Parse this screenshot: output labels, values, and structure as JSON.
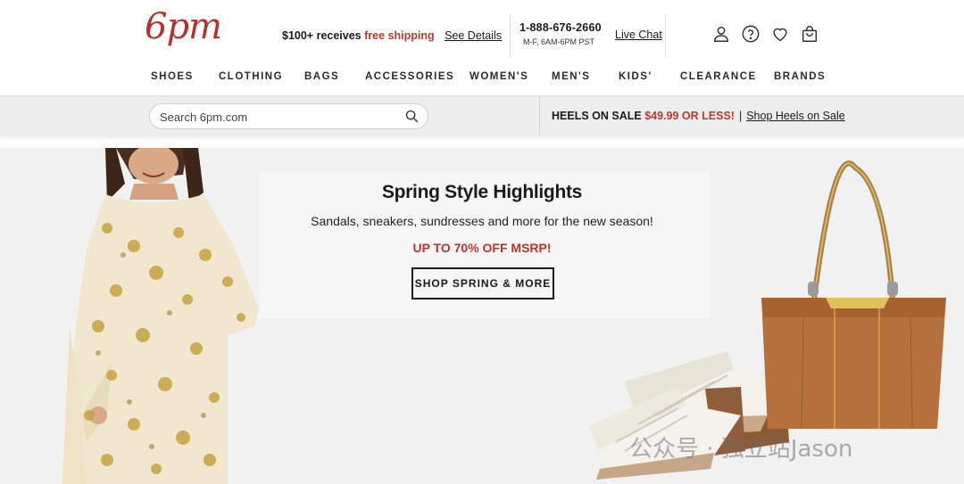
{
  "brand": {
    "logo_text": "6pm",
    "accent": "#b5322e"
  },
  "header": {
    "promo_lead": "$100+ receives",
    "promo_highlight": "free shipping",
    "promo_link": "See Details",
    "phone": "1-888-676-2660",
    "hours": "M-F, 6AM-6PM PST",
    "live_chat": "Live Chat",
    "icons": [
      "account-icon",
      "help-icon",
      "favorites-icon",
      "bag-icon"
    ]
  },
  "nav": {
    "items": [
      {
        "label": "SHOES"
      },
      {
        "label": "CLOTHING"
      },
      {
        "label": "BAGS"
      },
      {
        "label": "ACCESSORIES"
      },
      {
        "label": "WOMEN'S"
      },
      {
        "label": "MEN'S"
      },
      {
        "label": "KIDS'"
      },
      {
        "label": "CLEARANCE"
      },
      {
        "label": "BRANDS"
      }
    ]
  },
  "search": {
    "placeholder": "Search 6pm.com"
  },
  "promo_bar": {
    "lead": "HEELS ON SALE",
    "price": "$49.99 OR LESS!",
    "separator": "|",
    "link": "Shop Heels on Sale"
  },
  "hero": {
    "title": "Spring Style Highlights",
    "subtitle": "Sandals, sneakers, sundresses and more for the new season!",
    "offer": "UP TO 70% OFF MSRP!",
    "button": "SHOP SPRING & MORE"
  },
  "watermark": "公众号 · 独立站Jason",
  "colors": {
    "sale_red": "#c0392b",
    "strip_bg": "#ededed",
    "hero_bg": "#f1f1f1"
  }
}
